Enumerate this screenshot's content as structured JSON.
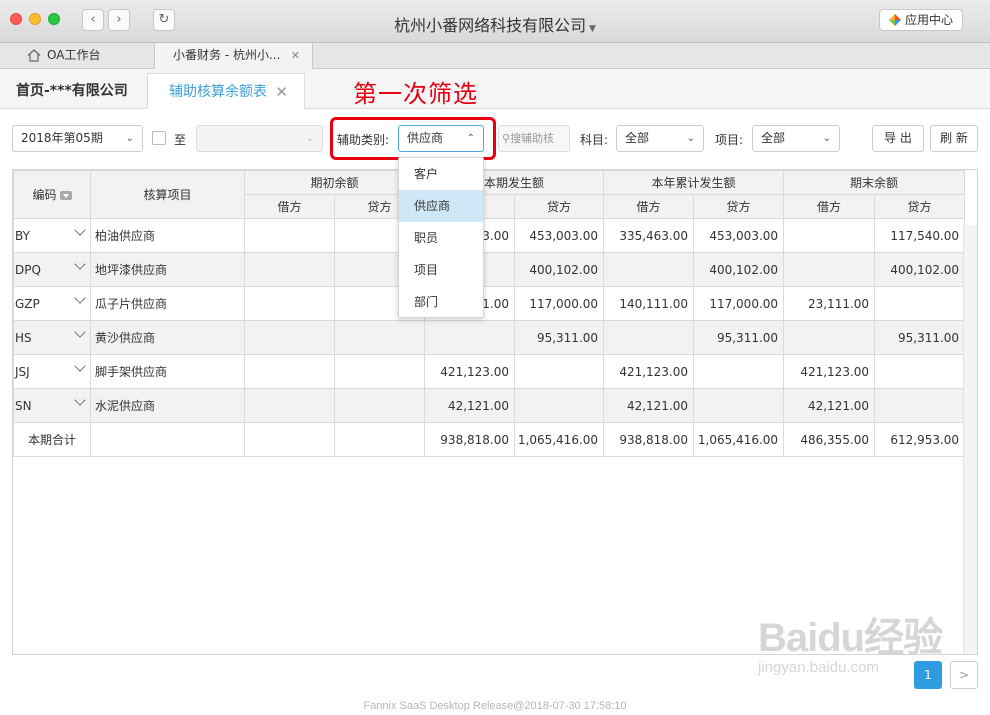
{
  "window": {
    "title": "杭州小番网络科技有限公司",
    "app_center": "应用中心"
  },
  "browser_tabs": [
    {
      "label": "OA工作台"
    },
    {
      "label": "小番财务 - 杭州小..."
    }
  ],
  "app_tabs": {
    "home": "首页-***有限公司",
    "active": "辅助核算余额表"
  },
  "annotation": "第一次筛选",
  "toolbar": {
    "period": "2018年第05期",
    "to_label": "至",
    "period_end": "",
    "aux_label": "辅助类别:",
    "aux_value": "供应商",
    "search_label": "搜辅助核",
    "subject_label": "科目:",
    "subject_value": "全部",
    "project_label": "项目:",
    "project_value": "全部",
    "export": "导 出",
    "refresh": "刷 新"
  },
  "dropdown": {
    "options": [
      "客户",
      "供应商",
      "职员",
      "项目",
      "部门"
    ],
    "selected_index": 1
  },
  "table": {
    "headers": {
      "code": "编码",
      "item": "核算项目",
      "opening": "期初余额",
      "period": "本期发生额",
      "ytd": "本年累计发生额",
      "closing": "期末余额",
      "debit": "借方",
      "credit": "贷方"
    },
    "rows": [
      {
        "code": "BY",
        "name": "柏油供应商",
        "open_d": "",
        "open_c": "",
        "per_d": "3.00",
        "per_c": "453,003.00",
        "ytd_d": "335,463.00",
        "ytd_c": "453,003.00",
        "close_d": "",
        "close_c": "117,540.00"
      },
      {
        "code": "DPQ",
        "name": "地坪漆供应商",
        "open_d": "",
        "open_c": "",
        "per_d": "",
        "per_c": "400,102.00",
        "ytd_d": "",
        "ytd_c": "400,102.00",
        "close_d": "",
        "close_c": "400,102.00"
      },
      {
        "code": "GZP",
        "name": "瓜子片供应商",
        "open_d": "",
        "open_c": "",
        "per_d": "1.00",
        "per_c": "117,000.00",
        "ytd_d": "140,111.00",
        "ytd_c": "117,000.00",
        "close_d": "23,111.00",
        "close_c": ""
      },
      {
        "code": "HS",
        "name": "黄沙供应商",
        "open_d": "",
        "open_c": "",
        "per_d": "",
        "per_c": "95,311.00",
        "ytd_d": "",
        "ytd_c": "95,311.00",
        "close_d": "",
        "close_c": "95,311.00"
      },
      {
        "code": "JSJ",
        "name": "脚手架供应商",
        "open_d": "",
        "open_c": "",
        "per_d": "421,123.00",
        "per_c": "",
        "ytd_d": "421,123.00",
        "ytd_c": "",
        "close_d": "421,123.00",
        "close_c": ""
      },
      {
        "code": "SN",
        "name": "水泥供应商",
        "open_d": "",
        "open_c": "",
        "per_d": "42,121.00",
        "per_c": "",
        "ytd_d": "42,121.00",
        "ytd_c": "",
        "close_d": "42,121.00",
        "close_c": ""
      }
    ],
    "total": {
      "label": "本期合计",
      "open_d": "",
      "open_c": "",
      "per_d": "938,818.00",
      "per_c": "1,065,416.00",
      "ytd_d": "938,818.00",
      "ytd_c": "1,065,416.00",
      "close_d": "486,355.00",
      "close_c": "612,953.00"
    }
  },
  "pagination": {
    "current": "1",
    "next": ">"
  },
  "footer": "Fannix SaaS Desktop Release@2018-07-30 17:58:10",
  "watermark": {
    "line1": "Baidu经验",
    "line2": "jingyan.baidu.com"
  }
}
